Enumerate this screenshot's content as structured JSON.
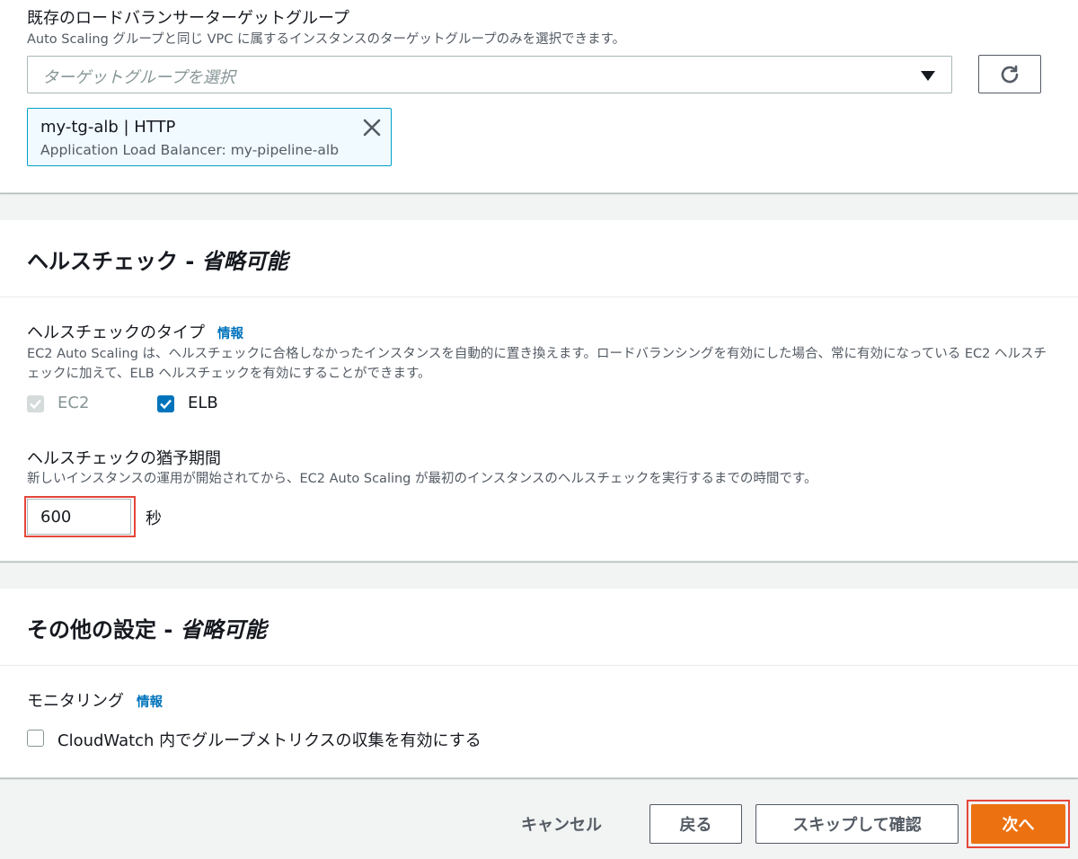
{
  "target_group": {
    "label": "既存のロードバランサーターゲットグループ",
    "description": "Auto Scaling グループと同じ VPC に属するインスタンスのターゲットグループのみを選択できます。",
    "select_placeholder": "ターゲットグループを選択",
    "token_title": "my-tg-alb | HTTP",
    "token_subtitle": "Application Load Balancer: my-pipeline-alb"
  },
  "health_check": {
    "section_title": "ヘルスチェック - ",
    "section_title_optional": "省略可能",
    "type_label": "ヘルスチェックのタイプ",
    "info": "情報",
    "type_description": "EC2 Auto Scaling は、ヘルスチェックに合格しなかったインスタンスを自動的に置き換えます。ロードバランシングを有効にした場合、常に有効になっている EC2 ヘルスチェックに加えて、ELB ヘルスチェックを有効にすることができます。",
    "ec2_label": "EC2",
    "elb_label": "ELB",
    "grace_label": "ヘルスチェックの猶予期間",
    "grace_description": "新しいインスタンスの運用が開始されてから、EC2 Auto Scaling が最初のインスタンスのヘルスチェックを実行するまでの時間です。",
    "grace_value": "600",
    "grace_unit": "秒"
  },
  "other": {
    "section_title": "その他の設定 - ",
    "section_title_optional": "省略可能",
    "monitoring_label": "モニタリング",
    "info": "情報",
    "cloudwatch_label": "CloudWatch 内でグループメトリクスの収集を有効にする"
  },
  "footer": {
    "cancel": "キャンセル",
    "back": "戻る",
    "skip": "スキップして確認",
    "next": "次へ"
  },
  "colors": {
    "primary": "#ec7211",
    "link": "#0073bb",
    "checkbox_checked": "#0073bb",
    "highlight": "#e4473b"
  }
}
